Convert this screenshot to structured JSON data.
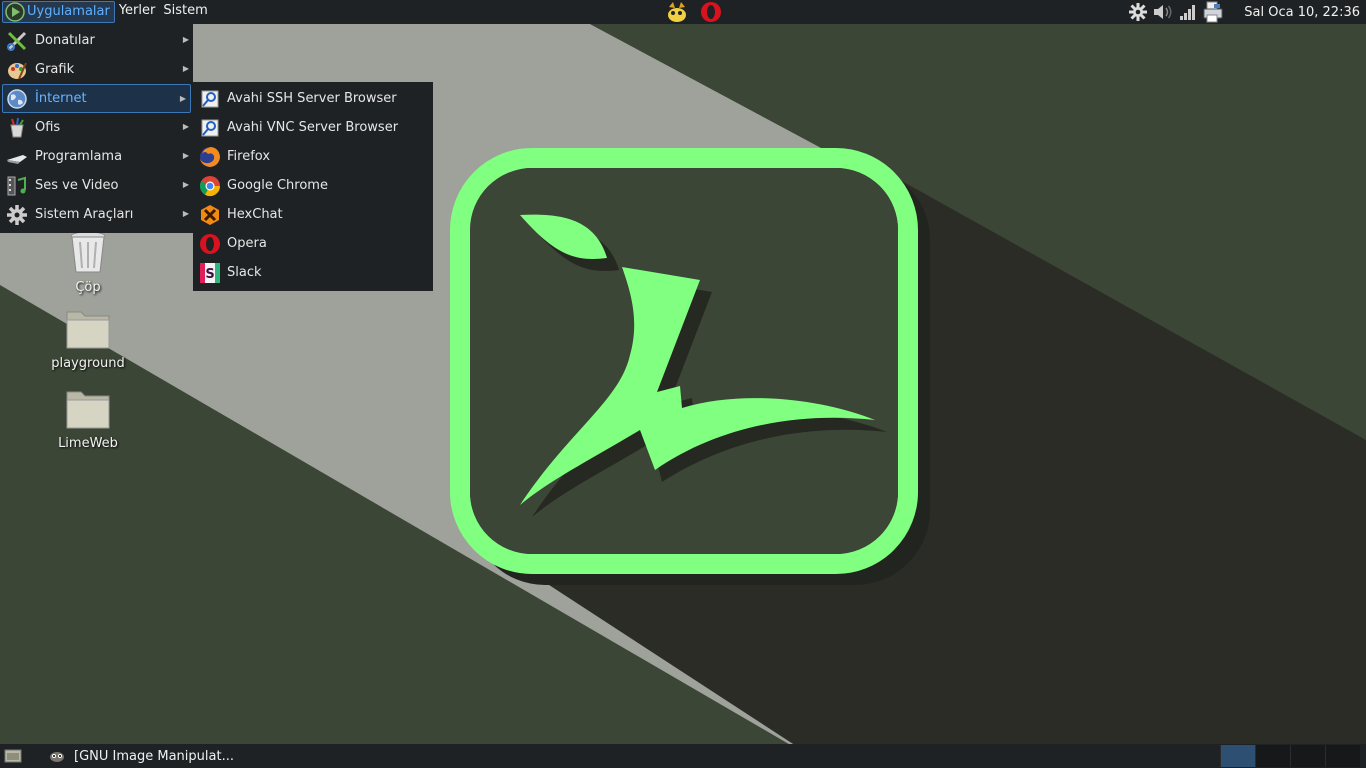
{
  "top_panel": {
    "menus": [
      {
        "label": "Uygulamalar",
        "icon": "mint-logo-icon"
      },
      {
        "label": "Yerler"
      },
      {
        "label": "Sistem"
      }
    ],
    "launchers": [
      "weather-icon",
      "opera-icon"
    ],
    "tray_icons": [
      "settings-icon",
      "volume-icon",
      "network-icon",
      "printer-icon"
    ],
    "clock": "Sal Oca 10, 22:36"
  },
  "apps_menu": {
    "items": [
      {
        "label": "Donatılar",
        "icon": "accessories-icon"
      },
      {
        "label": "Grafik",
        "icon": "graphics-icon"
      },
      {
        "label": "İnternet",
        "icon": "internet-globe-icon",
        "selected": true
      },
      {
        "label": "Ofis",
        "icon": "office-icon"
      },
      {
        "label": "Programlama",
        "icon": "programming-icon"
      },
      {
        "label": "Ses ve Video",
        "icon": "multimedia-icon"
      },
      {
        "label": "Sistem Araçları",
        "icon": "system-tools-icon"
      }
    ]
  },
  "internet_submenu": {
    "items": [
      {
        "label": "Avahi SSH Server Browser",
        "icon": "avahi-icon"
      },
      {
        "label": "Avahi VNC Server Browser",
        "icon": "avahi-icon"
      },
      {
        "label": "Firefox",
        "icon": "firefox-icon"
      },
      {
        "label": "Google Chrome",
        "icon": "chrome-icon"
      },
      {
        "label": "HexChat",
        "icon": "hexchat-icon"
      },
      {
        "label": "Opera",
        "icon": "opera-icon"
      },
      {
        "label": "Slack",
        "icon": "slack-icon"
      }
    ]
  },
  "desktop_icons": [
    {
      "label": "Çöp",
      "icon": "trash-icon"
    },
    {
      "label": "playground",
      "icon": "folder-icon"
    },
    {
      "label": "LimeWeb",
      "icon": "folder-icon"
    }
  ],
  "bottom_panel": {
    "task": "[GNU Image Manipulat...",
    "workspace_count": 4,
    "active_workspace": 1
  },
  "colors": {
    "panel_bg": "#1f2225",
    "selection_border": "#3c77b8",
    "selection_text": "#6ab4ff",
    "logo_green": "#80ff80",
    "wallpaper_dark": "#3c4636",
    "wallpaper_light": "#9fa29b"
  }
}
